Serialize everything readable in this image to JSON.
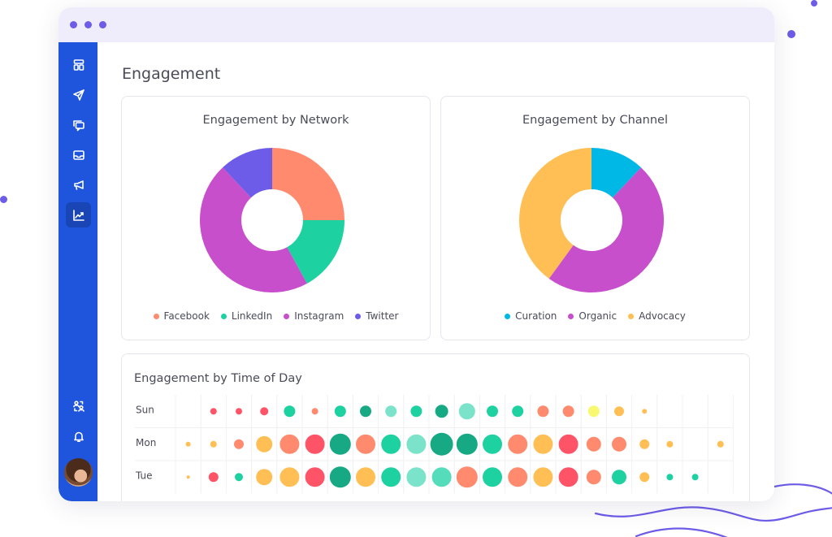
{
  "window": {
    "title_dots": 3,
    "page_title": "Engagement"
  },
  "sidebar": {
    "items": [
      {
        "name": "dashboard",
        "icon": "layout-icon",
        "active": false
      },
      {
        "name": "publish",
        "icon": "send-icon",
        "active": false
      },
      {
        "name": "messages",
        "icon": "chat-icon",
        "active": false
      },
      {
        "name": "inbox",
        "icon": "inbox-icon",
        "active": false
      },
      {
        "name": "campaigns",
        "icon": "megaphone-icon",
        "active": false
      },
      {
        "name": "analytics",
        "icon": "chart-line-icon",
        "active": true
      }
    ],
    "bottom_items": [
      {
        "name": "switch-users",
        "icon": "users-switch-icon"
      },
      {
        "name": "notifications",
        "icon": "bell-icon"
      }
    ],
    "avatar": "user-avatar"
  },
  "colors": {
    "accent": "#6c5ce7",
    "sidebar": "#1f55dc",
    "facebook": "#ff8a6e",
    "linkedin": "#1dd1a1",
    "instagram": "#c84fcb",
    "twitter": "#6c5ce7",
    "curation": "#00b8e6",
    "organic": "#c84fcb",
    "advocacy": "#ffbf55"
  },
  "chart_data": [
    {
      "type": "pie",
      "variant": "donut",
      "title": "Engagement by Network",
      "categories": [
        "Facebook",
        "LinkedIn",
        "Instagram",
        "Twitter"
      ],
      "values": [
        25,
        17,
        46,
        12
      ],
      "colors": [
        "#ff8a6e",
        "#1dd1a1",
        "#c84fcb",
        "#6c5ce7"
      ],
      "legend": "bottom"
    },
    {
      "type": "pie",
      "variant": "donut",
      "title": "Engagement by Channel",
      "categories": [
        "Curation",
        "Organic",
        "Advocacy"
      ],
      "values": [
        12,
        48,
        40
      ],
      "colors": [
        "#00b8e6",
        "#c84fcb",
        "#ffbf55"
      ],
      "legend": "bottom"
    },
    {
      "type": "heatmap",
      "variant": "bubble",
      "title": "Engagement by Time of Day",
      "rows": [
        "Sun",
        "Mon",
        "Tue"
      ],
      "columns_count": 22,
      "palette": {
        "red": "#ff5468",
        "coral": "#ff8a6e",
        "orange": "#ffbf55",
        "yellow": "#f9f871",
        "teal": "#1dd1a1",
        "darkteal": "#16a984",
        "mint": "#7be3c9",
        "seafoam": "#55dcbb"
      },
      "cells": [
        [
          null,
          [
            4,
            "red"
          ],
          [
            4,
            "red"
          ],
          [
            5,
            "red"
          ],
          [
            7,
            "teal"
          ],
          [
            4,
            "coral"
          ],
          [
            7,
            "teal"
          ],
          [
            7,
            "darkteal"
          ],
          [
            7,
            "mint"
          ],
          [
            7,
            "teal"
          ],
          [
            8,
            "darkteal"
          ],
          [
            10,
            "mint"
          ],
          [
            7,
            "teal"
          ],
          [
            7,
            "teal"
          ],
          [
            7,
            "coral"
          ],
          [
            7,
            "coral"
          ],
          [
            7,
            "yellow"
          ],
          [
            6,
            "orange"
          ],
          [
            3,
            "orange"
          ],
          null,
          null,
          null
        ],
        [
          [
            3,
            "orange"
          ],
          [
            4,
            "orange"
          ],
          [
            6,
            "coral"
          ],
          [
            10,
            "orange"
          ],
          [
            12,
            "coral"
          ],
          [
            12,
            "red"
          ],
          [
            13,
            "darkteal"
          ],
          [
            12,
            "coral"
          ],
          [
            12,
            "teal"
          ],
          [
            12,
            "mint"
          ],
          [
            14,
            "darkteal"
          ],
          [
            13,
            "darkteal"
          ],
          [
            12,
            "teal"
          ],
          [
            12,
            "coral"
          ],
          [
            12,
            "orange"
          ],
          [
            12,
            "red"
          ],
          [
            9,
            "coral"
          ],
          [
            9,
            "coral"
          ],
          [
            6,
            "orange"
          ],
          [
            4,
            "orange"
          ],
          null,
          [
            4,
            "orange"
          ]
        ],
        [
          [
            2,
            "orange"
          ],
          [
            6,
            "red"
          ],
          [
            5,
            "teal"
          ],
          [
            10,
            "orange"
          ],
          [
            12,
            "orange"
          ],
          [
            12,
            "red"
          ],
          [
            13,
            "darkteal"
          ],
          [
            12,
            "orange"
          ],
          [
            12,
            "teal"
          ],
          [
            12,
            "mint"
          ],
          [
            12,
            "seafoam"
          ],
          [
            13,
            "coral"
          ],
          [
            12,
            "teal"
          ],
          [
            12,
            "coral"
          ],
          [
            12,
            "orange"
          ],
          [
            12,
            "red"
          ],
          [
            9,
            "coral"
          ],
          [
            9,
            "teal"
          ],
          [
            6,
            "orange"
          ],
          [
            4,
            "teal"
          ],
          [
            4,
            "teal"
          ],
          null
        ]
      ]
    }
  ]
}
